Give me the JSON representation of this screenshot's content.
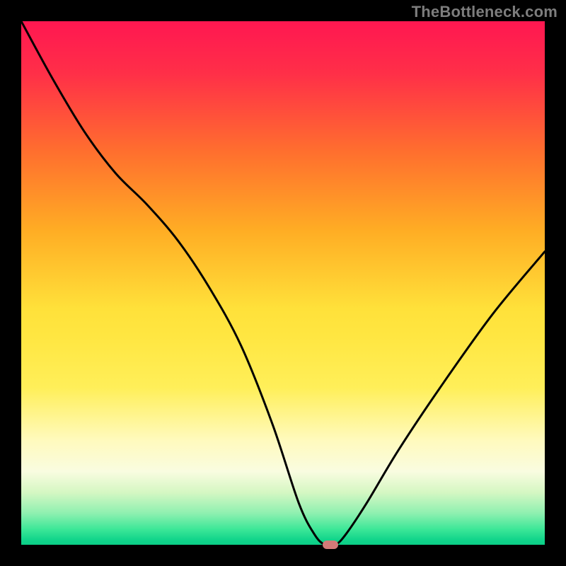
{
  "watermark": "TheBottleneck.com",
  "chart_data": {
    "type": "line",
    "title": "",
    "xlabel": "",
    "ylabel": "",
    "xlim": [
      0,
      100
    ],
    "ylim": [
      0,
      100
    ],
    "grid": false,
    "legend": false,
    "series": [
      {
        "name": "curve",
        "x": [
          0,
          6,
          12,
          18,
          24,
          30,
          36,
          42,
          48,
          53,
          56,
          58,
          60,
          62,
          66,
          72,
          80,
          90,
          100
        ],
        "values": [
          100,
          89,
          79,
          71,
          65,
          58,
          49,
          38,
          23,
          8,
          2,
          0,
          0,
          2,
          8,
          18,
          30,
          44,
          56
        ]
      }
    ],
    "marker": {
      "x": 59,
      "y": 0,
      "color": "#d37a78"
    },
    "background_gradient": {
      "top": "#ff1751",
      "mid": "#ffe13a",
      "bottom": "#0bce87"
    }
  }
}
